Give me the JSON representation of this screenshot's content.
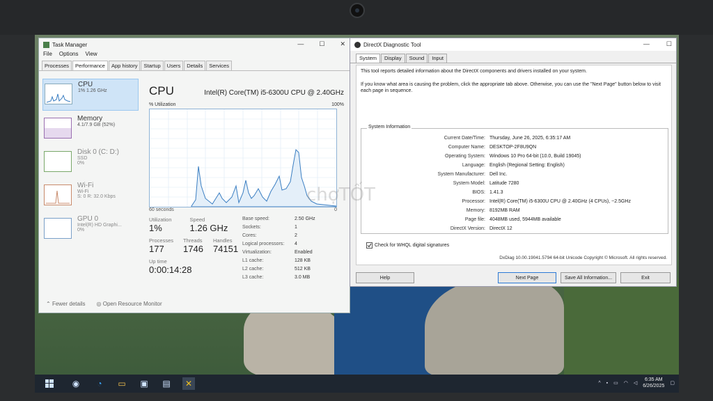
{
  "task_manager": {
    "title": "Task Manager",
    "menu": [
      "File",
      "Options",
      "View"
    ],
    "tabs": [
      "Processes",
      "Performance",
      "App history",
      "Startup",
      "Users",
      "Details",
      "Services"
    ],
    "active_tab": "Performance",
    "sidebar": [
      {
        "name": "CPU",
        "sub": "1% 1.26 GHz",
        "sub2": ""
      },
      {
        "name": "Memory",
        "sub": "4.1/7.9 GB (52%)",
        "sub2": ""
      },
      {
        "name": "Disk 0 (C: D:)",
        "sub": "SSD",
        "sub2": "0%"
      },
      {
        "name": "Wi-Fi",
        "sub": "Wi-Fi",
        "sub2": "S: 0 R: 32.0 Kbps"
      },
      {
        "name": "GPU 0",
        "sub": "Intel(R) HD Graphi...",
        "sub2": "0%"
      }
    ],
    "main": {
      "title": "CPU",
      "model": "Intel(R) Core(TM) i5-6300U CPU @ 2.40GHz",
      "util_label": "% Utilization",
      "util_max": "100%",
      "time_label": "60 seconds",
      "time_zero": "0",
      "utilization_label": "Utilization",
      "utilization": "1%",
      "speed_label": "Speed",
      "speed": "1.26 GHz",
      "processes_label": "Processes",
      "processes": "177",
      "threads_label": "Threads",
      "threads": "1746",
      "handles_label": "Handles",
      "handles": "74151",
      "uptime_label": "Up time",
      "uptime": "0:00:14:28",
      "specs": [
        {
          "k": "Base speed:",
          "v": "2.50 GHz"
        },
        {
          "k": "Sockets:",
          "v": "1"
        },
        {
          "k": "Cores:",
          "v": "2"
        },
        {
          "k": "Logical processors:",
          "v": "4"
        },
        {
          "k": "Virtualization:",
          "v": "Enabled"
        },
        {
          "k": "L1 cache:",
          "v": "128 KB"
        },
        {
          "k": "L2 cache:",
          "v": "512 KB"
        },
        {
          "k": "L3 cache:",
          "v": "3.0 MB"
        }
      ]
    },
    "footer": {
      "fewer": "Fewer details",
      "monitor": "Open Resource Monitor"
    }
  },
  "dxdiag": {
    "title": "DirectX Diagnostic Tool",
    "tabs": [
      "System",
      "Display",
      "Sound",
      "Input"
    ],
    "intro1": "This tool reports detailed information about the DirectX components and drivers installed on your system.",
    "intro2": "If you know what area is causing the problem, click the appropriate tab above.  Otherwise, you can use the \"Next Page\" button below to visit each page in sequence.",
    "group_label": "System Information",
    "rows": [
      {
        "k": "Current Date/Time:",
        "v": "Thursday, June 26, 2025, 6:35:17 AM"
      },
      {
        "k": "Computer Name:",
        "v": "DESKTOP-2F8U9QN"
      },
      {
        "k": "Operating System:",
        "v": "Windows 10 Pro 64-bit (10.0, Build 19045)"
      },
      {
        "k": "Language:",
        "v": "English (Regional Setting: English)"
      },
      {
        "k": "System Manufacturer:",
        "v": "Dell Inc."
      },
      {
        "k": "System Model:",
        "v": "Latitude 7280"
      },
      {
        "k": "BIOS:",
        "v": "1.41.3"
      },
      {
        "k": "Processor:",
        "v": "Intel(R) Core(TM) i5-6300U CPU @ 2.40GHz (4 CPUs), ~2.5GHz"
      },
      {
        "k": "Memory:",
        "v": "8192MB RAM"
      },
      {
        "k": "Page file:",
        "v": "4048MB used, 5944MB available"
      },
      {
        "k": "DirectX Version:",
        "v": "DirectX 12"
      }
    ],
    "whql": "Check for WHQL digital signatures",
    "copyright": "DxDiag 10.00.19041.5794 64-bit Unicode  Copyright © Microsoft. All rights reserved.",
    "buttons": {
      "help": "Help",
      "next": "Next Page",
      "save": "Save All Information...",
      "exit": "Exit"
    }
  },
  "watermark": "chợTỐT",
  "taskbar": {
    "time": "6:35 AM",
    "date": "6/26/2025"
  }
}
